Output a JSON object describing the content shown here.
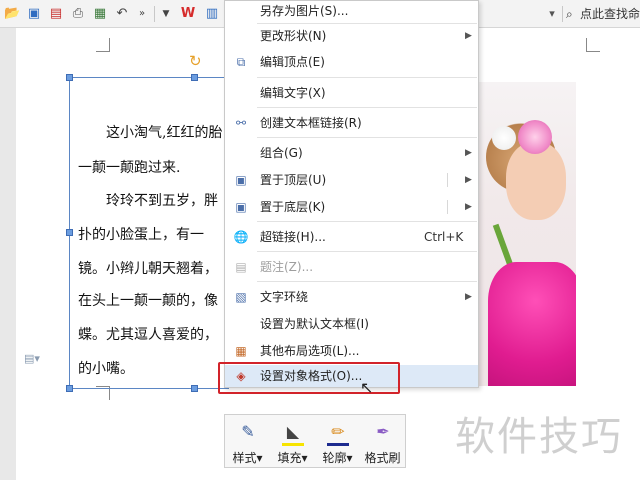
{
  "toolbar": {
    "search_text": "点此查找命",
    "icons": [
      "open-folder-icon",
      "save-icon",
      "pdf-icon",
      "print-icon",
      "print-preview-icon",
      "undo-icon",
      "more-icon",
      "dropdown-icon",
      "wps-logo-icon",
      "textbox-icon",
      "filter-icon",
      "search-icon"
    ]
  },
  "document": {
    "lines": [
      "　　这小淘气,红红的胎",
      "一颠一颠跑过来.",
      "　　玲玲不到五岁，胖",
      "扑的小脸蛋上，有一",
      "镜。小辫儿朝天翘着，",
      "在头上一颠一颠的，像",
      "蝶。尤其逗人喜爱的，",
      "的小嘴。"
    ]
  },
  "menu": {
    "items": [
      {
        "label": "另存为图片(S)...",
        "icon": "",
        "arrow": false
      },
      {
        "label": "更改形状(N)",
        "icon": "",
        "arrow": true
      },
      {
        "label": "编辑顶点(E)",
        "icon": "edit-points-icon",
        "arrow": false
      },
      {
        "label": "编辑文字(X)",
        "icon": "",
        "arrow": false
      },
      {
        "label": "创建文本框链接(R)",
        "icon": "link-textbox-icon",
        "arrow": false
      },
      {
        "label": "组合(G)",
        "icon": "",
        "arrow": true
      },
      {
        "label": "置于顶层(U)",
        "icon": "bring-to-front-icon",
        "arrow": true
      },
      {
        "label": "置于底层(K)",
        "icon": "send-to-back-icon",
        "arrow": true
      },
      {
        "label": "超链接(H)...",
        "icon": "hyperlink-icon",
        "shortcut": "Ctrl+K"
      },
      {
        "label": "题注(Z)...",
        "icon": "caption-icon",
        "disabled": true
      },
      {
        "label": "文字环绕",
        "icon": "text-wrap-icon",
        "arrow": true
      },
      {
        "label": "设置为默认文本框(I)",
        "icon": "",
        "arrow": false
      },
      {
        "label": "其他布局选项(L)...",
        "icon": "layout-options-icon",
        "arrow": false
      },
      {
        "label": "设置对象格式(O)...",
        "icon": "format-object-icon",
        "arrow": false
      }
    ]
  },
  "floatbar": {
    "buttons": [
      {
        "label": "样式",
        "icon": "style-brush-icon",
        "bar_color": ""
      },
      {
        "label": "填充",
        "icon": "fill-bucket-icon",
        "bar_color": "#f7e400"
      },
      {
        "label": "轮廓",
        "icon": "outline-pen-icon",
        "bar_color": "#1d2b8f"
      },
      {
        "label": "格式刷",
        "icon": "format-painter-icon",
        "bar_color": ""
      }
    ]
  },
  "watermark": "软件技巧"
}
